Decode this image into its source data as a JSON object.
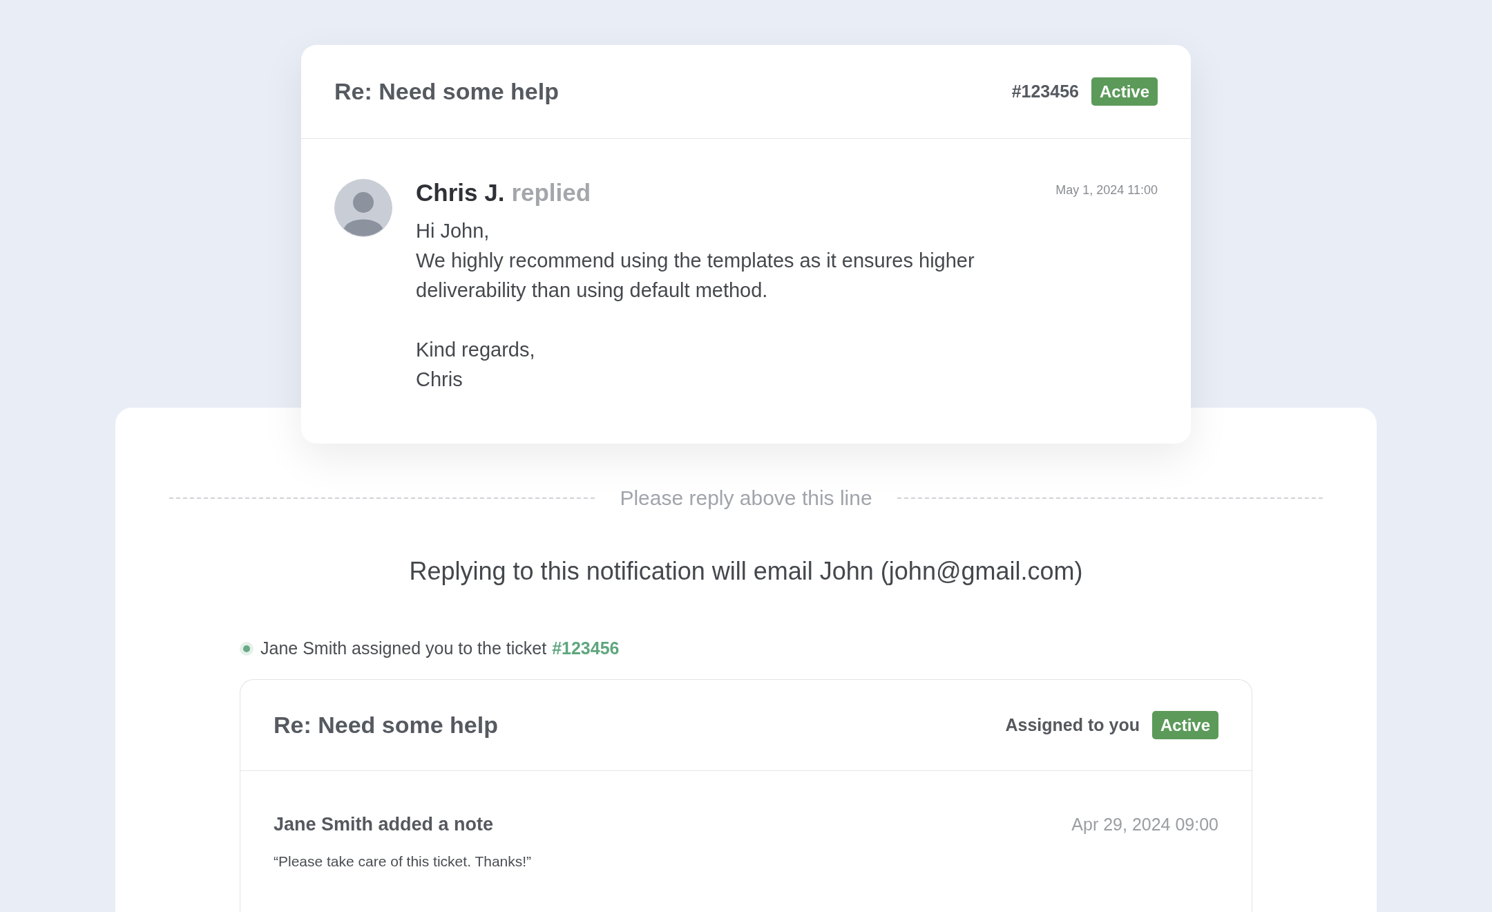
{
  "ticket_card": {
    "title": "Re: Need some help",
    "ticket_number": "#123456",
    "status": {
      "label": "Active",
      "kind": "active"
    }
  },
  "message": {
    "author": "Chris J.",
    "action": "replied",
    "timestamp": "May 1, 2024 11:00",
    "greeting": "Hi John,",
    "body": "We highly recommend using the templates as it ensures higher deliverability than using default method.",
    "signoff": "Kind regards,",
    "signature": "Chris"
  },
  "reply_divider": "Please reply above this line",
  "notice": "Replying to this notification will email John (john@gmail.com)",
  "assignment": {
    "text": "Jane Smith assigned you to the ticket",
    "link": "#123456"
  },
  "assigned_card": {
    "title": "Re: Need some help",
    "assignee": "Assigned to you",
    "status": {
      "label": "Active",
      "kind": "active"
    },
    "note": {
      "heading": "Jane Smith added a note",
      "timestamp": "Apr 29, 2024 09:00",
      "text": "“Please take care of this ticket. Thanks!”"
    }
  }
}
